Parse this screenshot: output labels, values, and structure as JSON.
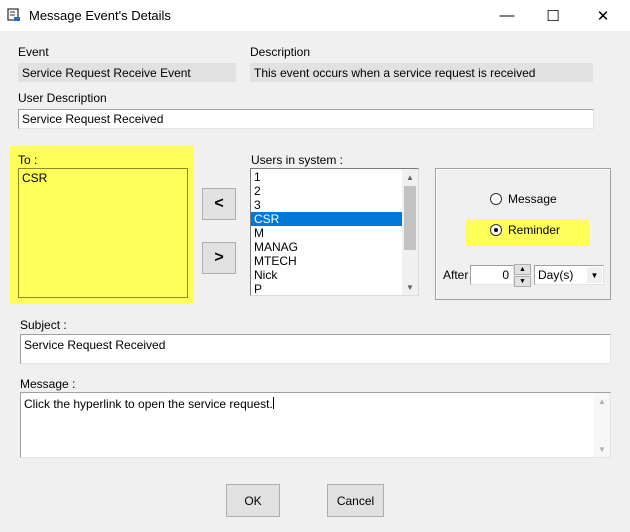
{
  "window": {
    "title": "Message Event's Details",
    "minimize": "—",
    "maximize": "☐",
    "close": "✕"
  },
  "event": {
    "label": "Event",
    "value": "Service Request Receive Event"
  },
  "description": {
    "label": "Description",
    "value": "This event occurs when a service request is received"
  },
  "user_description": {
    "label": "User Description",
    "value": "Service Request Received"
  },
  "to": {
    "label": "To :",
    "items": [
      "CSR"
    ]
  },
  "users": {
    "label": "Users in system :",
    "items": [
      "1",
      "2",
      "3",
      "CSR",
      "M",
      "MANAG",
      "MTECH",
      "Nick",
      "P"
    ],
    "selected": "CSR"
  },
  "transfer": {
    "remove_label": "<",
    "add_label": ">"
  },
  "notify_type": {
    "message_label": "Message",
    "reminder_label": "Reminder",
    "selected": "Reminder"
  },
  "after": {
    "label": "After",
    "value": "0",
    "unit": "Day(s)"
  },
  "subject": {
    "label": "Subject :",
    "value": "Service Request Received"
  },
  "message": {
    "label": "Message :",
    "value": "Click the hyperlink to open the service request."
  },
  "buttons": {
    "ok": "OK",
    "cancel": "Cancel"
  },
  "colors": {
    "highlight": "#ffff5a",
    "selection": "#0078d7"
  }
}
